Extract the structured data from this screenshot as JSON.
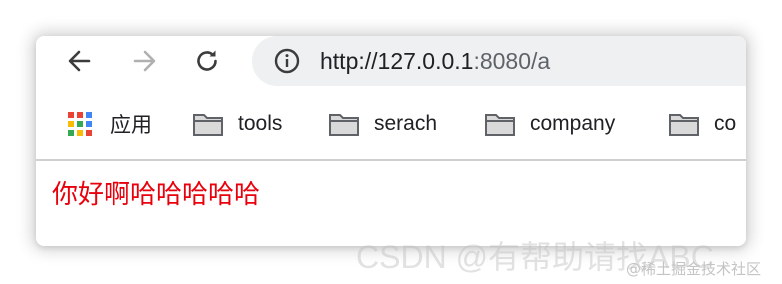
{
  "address_bar": {
    "url_host": "http://127.0.0.1",
    "url_rest": ":8080/a",
    "icon": "info-icon"
  },
  "nav": {
    "back_icon": "arrow-left-icon",
    "forward_icon": "arrow-right-icon",
    "reload_icon": "reload-icon"
  },
  "bookmarks": {
    "apps_label": "应用",
    "items": [
      {
        "label": "tools",
        "icon": "folder-icon"
      },
      {
        "label": "serach",
        "icon": "folder-icon"
      },
      {
        "label": "company",
        "icon": "folder-icon"
      },
      {
        "label": "co",
        "icon": "folder-icon"
      }
    ]
  },
  "page": {
    "body_text": "你好啊哈哈哈哈哈"
  },
  "watermarks": {
    "csdn": "CSDN @有帮助请找ABC",
    "juejin": "@稀土掘金技术社区"
  },
  "colors": {
    "body_text": "#e8000c",
    "omnibox_bg": "#eef0f1"
  }
}
